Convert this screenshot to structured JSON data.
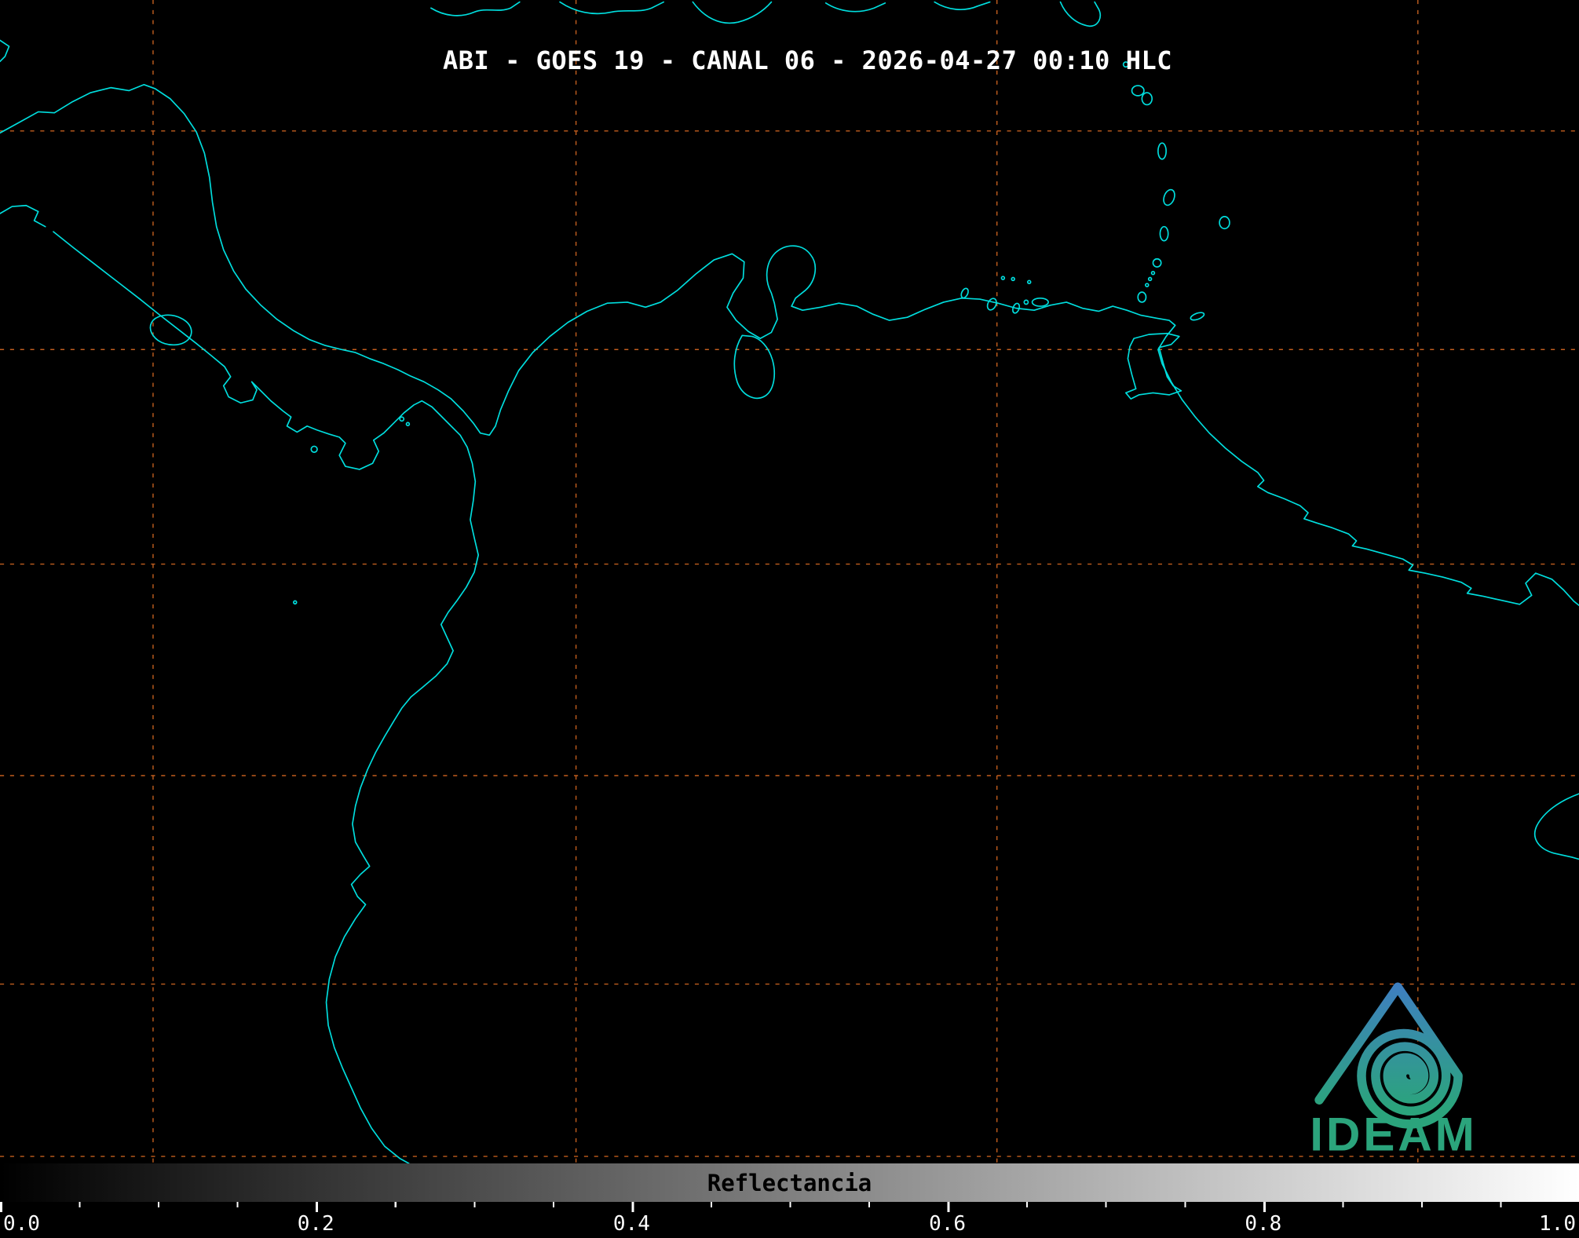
{
  "title": "ABI - GOES 19 - CANAL 06 - 2026-04-27 00:10 HLC",
  "colorbar": {
    "label": "Reflectancia",
    "ticks": [
      "0.0",
      "0.2",
      "0.4",
      "0.6",
      "0.8",
      "1.0"
    ],
    "gradient_start": "#000000",
    "gradient_end": "#ffffff"
  },
  "logo": {
    "text": "IDEAM",
    "blue": "#3f7ec2",
    "green": "#2ba47c"
  },
  "colors": {
    "background": "#000000",
    "coastline": "#00dede",
    "graticule": "#c25e1e",
    "title_text": "#ffffff",
    "tick_text": "#ffffff",
    "colorbar_label_text": "#000000"
  }
}
